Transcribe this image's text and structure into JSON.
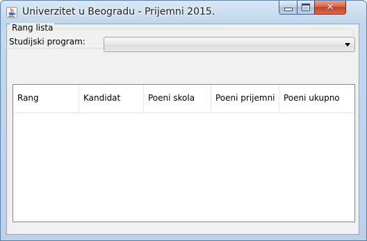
{
  "window": {
    "title": "Univerzitet u Beogradu - Prijemni 2015.",
    "icon": "java-cup-icon",
    "controls": {
      "minimize": "minimize-icon",
      "maximize": "maximize-icon",
      "close": "close-icon"
    }
  },
  "form": {
    "group_title": "Rang lista",
    "program_label": "Studijski program:",
    "program_selected": ""
  },
  "table": {
    "columns": [
      "Rang",
      "Kandidat",
      "Poeni skola",
      "Poeni prijemni",
      "Poeni ukupno"
    ],
    "rows": []
  }
}
